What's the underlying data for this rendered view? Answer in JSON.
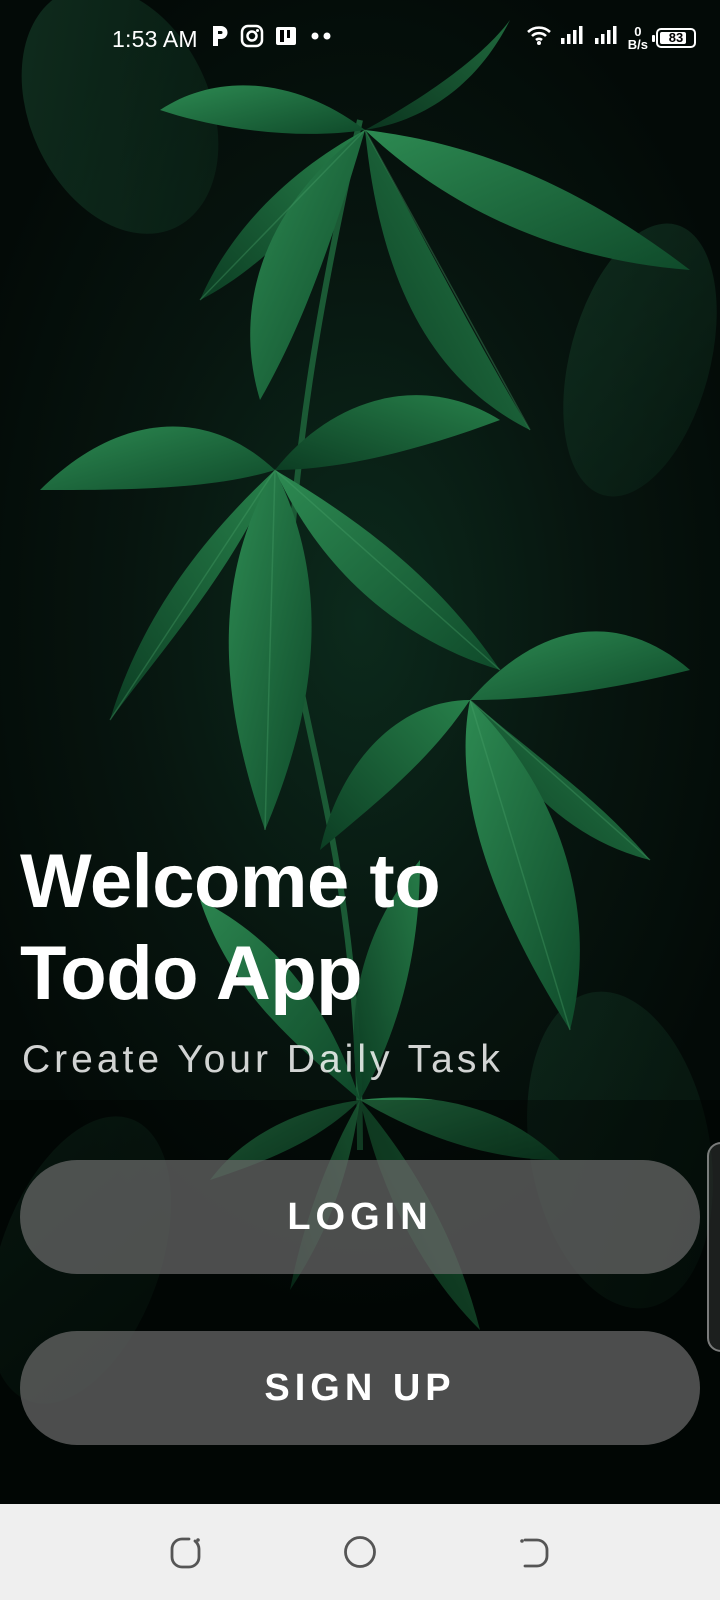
{
  "status_bar": {
    "time": "1:53 AM",
    "left_icons": [
      "parking-p-icon",
      "instagram-icon",
      "app-notification-icon",
      "more-dots-icon"
    ],
    "right_icons": [
      "wifi-icon",
      "signal-1-icon",
      "signal-2-icon"
    ],
    "net_speed_value": "0",
    "net_speed_unit": "B/s",
    "battery_level": "83"
  },
  "welcome": {
    "title_line1": "Welcome to",
    "title_line2": "Todo App",
    "subtitle": "Create Your Daily Task"
  },
  "buttons": {
    "login_label": "LOGIN",
    "signup_label": "SIGN UP"
  },
  "navigation": {
    "icons": [
      "recents-icon",
      "home-icon",
      "back-icon"
    ]
  },
  "colors": {
    "button_bg": "#696969",
    "nav_bg": "#efefef",
    "leaf_green": "#1f6b3d",
    "text_primary": "#ffffff"
  }
}
